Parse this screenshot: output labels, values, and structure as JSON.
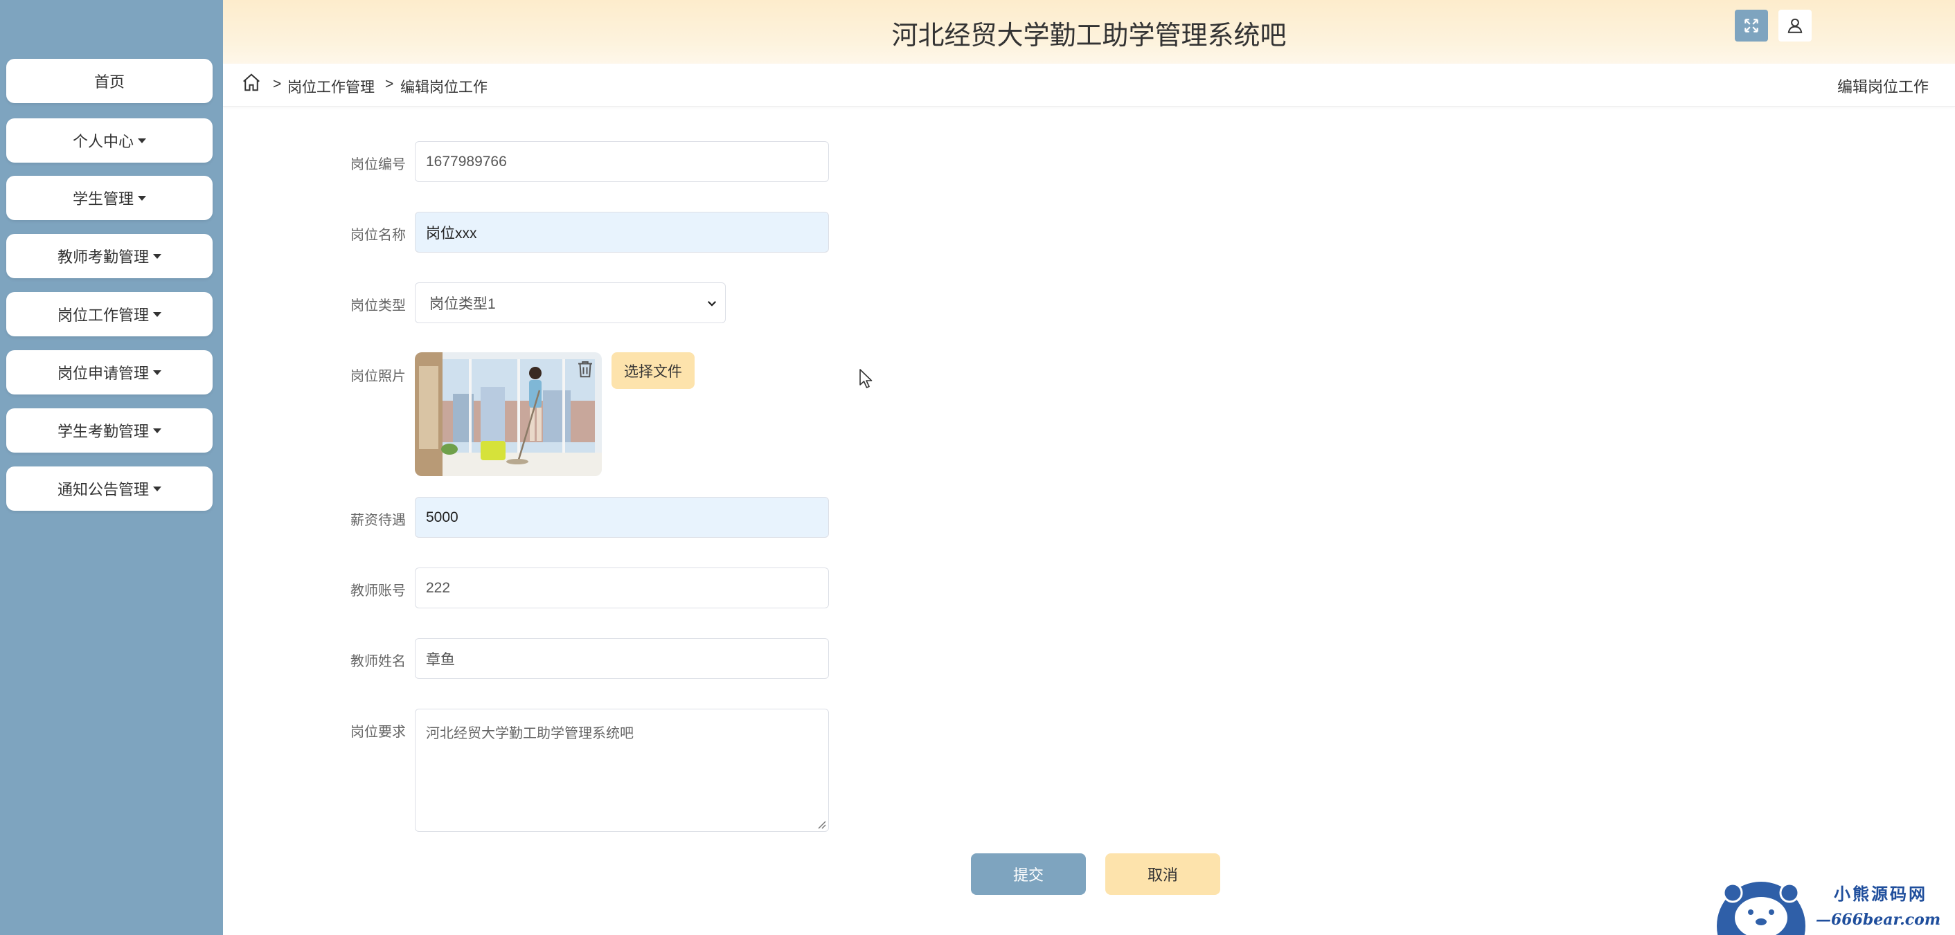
{
  "app": {
    "title": "河北经贸大学勤工助学管理系统吧"
  },
  "sidebar": {
    "items": [
      {
        "label": "首页",
        "dropdown": false
      },
      {
        "label": "个人中心",
        "dropdown": true
      },
      {
        "label": "学生管理",
        "dropdown": true
      },
      {
        "label": "教师考勤管理",
        "dropdown": true
      },
      {
        "label": "岗位工作管理",
        "dropdown": true
      },
      {
        "label": "岗位申请管理",
        "dropdown": true
      },
      {
        "label": "学生考勤管理",
        "dropdown": true
      },
      {
        "label": "通知公告管理",
        "dropdown": true
      }
    ]
  },
  "breadcrumb": {
    "sep1": ">",
    "item1": "岗位工作管理",
    "sep2": ">",
    "item2": "编辑岗位工作",
    "right": "编辑岗位工作"
  },
  "form": {
    "job_no": {
      "label": "岗位编号",
      "value": "1677989766"
    },
    "job_name": {
      "label": "岗位名称",
      "value": "岗位xxx"
    },
    "job_type": {
      "label": "岗位类型",
      "value": "岗位类型1"
    },
    "job_photo": {
      "label": "岗位照片",
      "choose_label": "选择文件"
    },
    "salary": {
      "label": "薪资待遇",
      "value": "5000"
    },
    "teacher_account": {
      "label": "教师账号",
      "value": "222"
    },
    "teacher_name": {
      "label": "教师姓名",
      "value": "章鱼"
    },
    "requirements": {
      "label": "岗位要求",
      "value": "河北经贸大学勤工助学管理系统吧"
    }
  },
  "actions": {
    "submit": "提交",
    "cancel": "取消"
  },
  "watermark": {
    "cn": "小熊源码网",
    "en": "—666bear.com—"
  },
  "colors": {
    "sidebar": "#7ea4bf",
    "accent_yellow": "#fde3ac",
    "filled_input": "#e8f3fd"
  }
}
